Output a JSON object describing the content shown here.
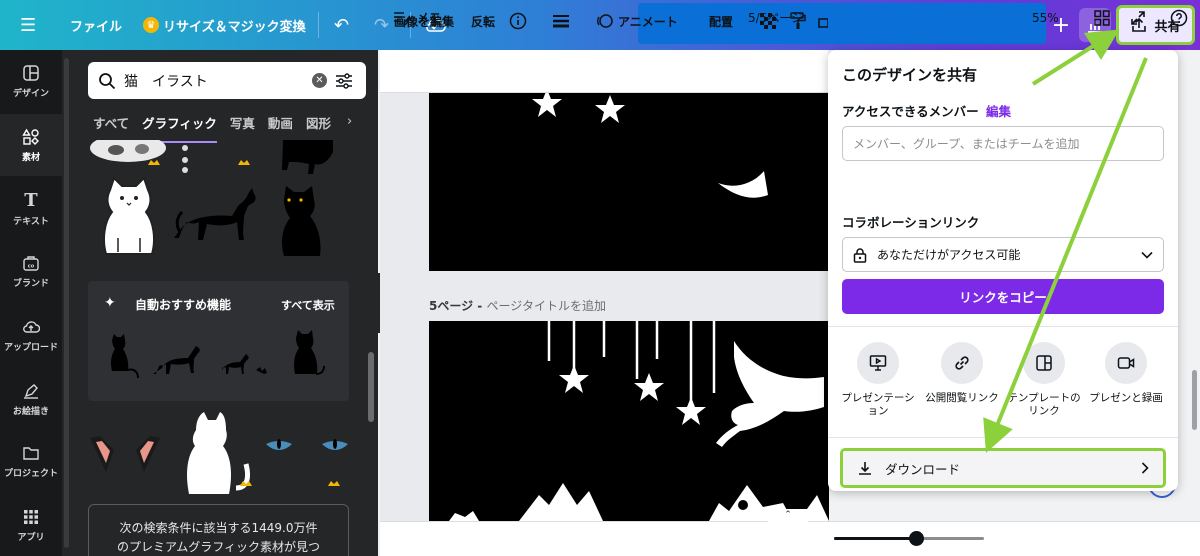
{
  "topbar": {
    "file_label": "ファイル",
    "resize_label": "リサイズ＆マジック変換",
    "share_label": "共有"
  },
  "rail": {
    "items": [
      {
        "label": "デザイン",
        "icon": "layout-icon"
      },
      {
        "label": "素材",
        "icon": "elements-icon"
      },
      {
        "label": "テキスト",
        "icon": "text-icon"
      },
      {
        "label": "ブランド",
        "icon": "brand-icon"
      },
      {
        "label": "アップロード",
        "icon": "cloud-upload-icon"
      },
      {
        "label": "お絵描き",
        "icon": "pen-icon"
      },
      {
        "label": "プロジェクト",
        "icon": "folder-icon"
      },
      {
        "label": "アプリ",
        "icon": "apps-grid-icon"
      }
    ]
  },
  "panel": {
    "search_value": "猫　イラスト",
    "tabs": [
      "すべて",
      "グラフィック",
      "写真",
      "動画",
      "図形"
    ],
    "recommend_title": "自動おすすめ機能",
    "recommend_all": "すべて表示",
    "notice_line1": "次の検索条件に該当する1449.0万件",
    "notice_line2": "のプレミアムグラフィック素材が見つ"
  },
  "toolbar": {
    "edit_image": "画像を編集",
    "flip": "反転",
    "animate": "アニメート",
    "arrange": "配置"
  },
  "canvas": {
    "page5_label": "5ページ -",
    "page5_title_placeholder": "ページタイトルを追加"
  },
  "bottombar": {
    "notes": "メモ",
    "page_counter": "5/5ページ",
    "zoom": "55%",
    "zoom_fraction": 0.55
  },
  "share_panel": {
    "title": "このデザインを共有",
    "members_label": "アクセスできるメンバー",
    "edit_link": "編集",
    "members_placeholder": "メンバー、グループ、またはチームを追加",
    "collab_label": "コラボレーションリンク",
    "access_value": "あなただけがアクセス可能",
    "copy_button": "リンクをコピー",
    "options": [
      {
        "label1": "プレゼンテーシ",
        "label2": "ョン",
        "icon": "presentation-icon"
      },
      {
        "label1": "公開閲覧リンク",
        "label2": "",
        "icon": "link-icon"
      },
      {
        "label1": "テンプレートの",
        "label2": "リンク",
        "icon": "template-icon"
      },
      {
        "label1": "プレゼンと録画",
        "label2": "",
        "icon": "video-record-icon"
      }
    ],
    "download_label": "ダウンロード"
  },
  "colors": {
    "accent_purple": "#7d2ae8",
    "highlight_green": "#8cd13b",
    "panel_dark": "#252627"
  }
}
